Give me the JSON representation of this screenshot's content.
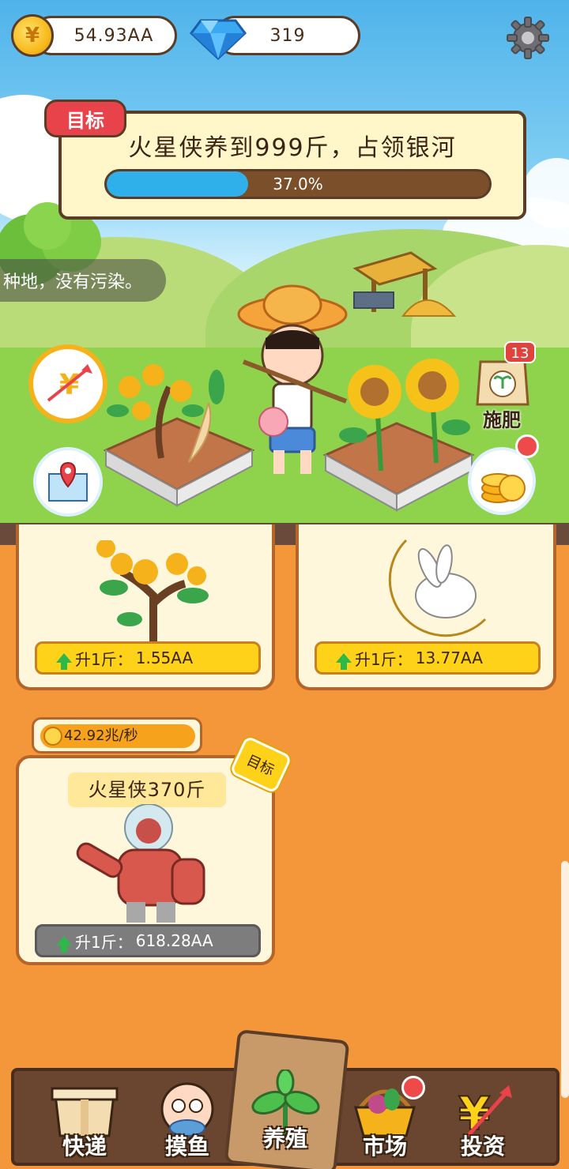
{
  "currency": {
    "coins": "54.93AA",
    "gems": "319"
  },
  "goal": {
    "tag": "目标",
    "text": "火星侠养到999斤，占领银河",
    "progress_text": "37.0%",
    "progress": 0.37
  },
  "notice": {
    "text": "种地，没有污染。"
  },
  "side_buttons": {
    "fertilizer_label": "施肥",
    "fertilizer_count": "13"
  },
  "cards": [
    {
      "name": "tree",
      "price_label": "升1斤：",
      "price_value": "1.55AA"
    },
    {
      "name": "moon-rabbit",
      "price_label": "升1斤：",
      "price_value": "13.77AA"
    }
  ],
  "featured": {
    "rate": "42.92兆/秒",
    "title": "火星侠370斤",
    "target_tag": "目标",
    "price_label": "升1斤：",
    "price_value": "618.28AA"
  },
  "nav": {
    "items": [
      {
        "label": "快递",
        "icon": "box-icon"
      },
      {
        "label": "摸鱼",
        "icon": "fish-icon"
      },
      {
        "label": "养殖",
        "icon": "sprout-icon"
      },
      {
        "label": "市场",
        "icon": "basket-icon"
      },
      {
        "label": "投资",
        "icon": "yuan-arrow-icon"
      }
    ],
    "active": "养殖"
  },
  "colors": {
    "accent": "#f4973a",
    "progress": "#2fb0ea",
    "price_bar": "#ffd21a",
    "alert": "#e8424a"
  }
}
